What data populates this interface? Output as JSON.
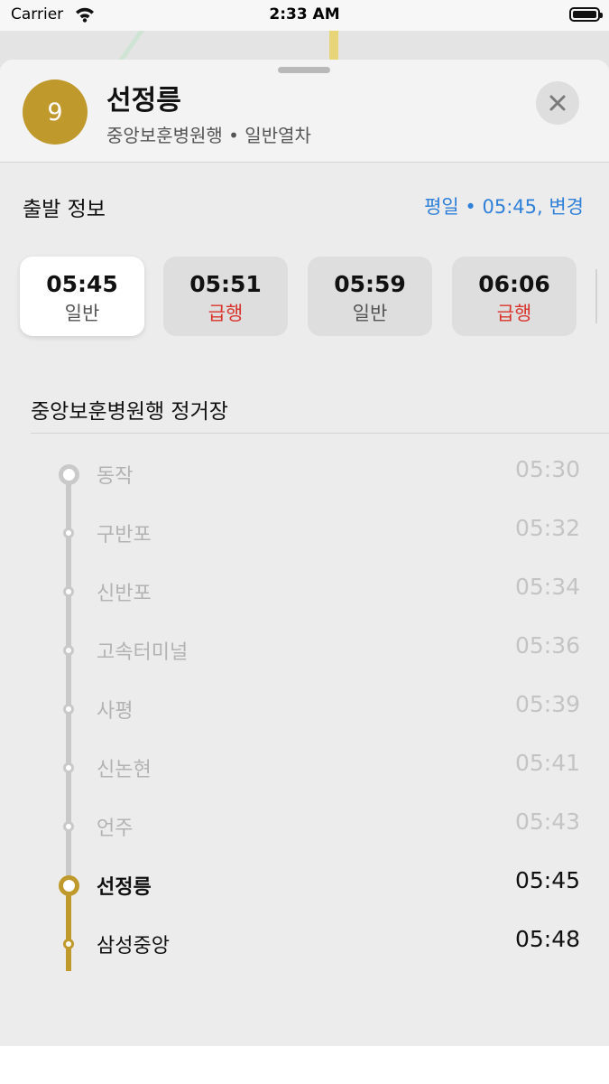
{
  "status_bar": {
    "carrier": "Carrier",
    "time": "2:33 AM"
  },
  "header": {
    "line_number": "9",
    "line_color": "#c0992d",
    "station_name": "선정릉",
    "subtitle": "중앙보훈병원행 • 일반열차"
  },
  "departure": {
    "title": "출발 정보",
    "link": "평일 • 05:45, 변경"
  },
  "times": [
    {
      "time": "05:45",
      "type": "일반",
      "selected": true,
      "express": false
    },
    {
      "time": "05:51",
      "type": "급행",
      "selected": false,
      "express": true
    },
    {
      "time": "05:59",
      "type": "일반",
      "selected": false,
      "express": false
    },
    {
      "time": "06:06",
      "type": "급행",
      "selected": false,
      "express": true
    }
  ],
  "stops_title": "중앙보훈병원행 정거장",
  "stops": [
    {
      "name": "동작",
      "time": "05:30",
      "state": "past"
    },
    {
      "name": "구반포",
      "time": "05:32",
      "state": "past"
    },
    {
      "name": "신반포",
      "time": "05:34",
      "state": "past"
    },
    {
      "name": "고속터미널",
      "time": "05:36",
      "state": "past"
    },
    {
      "name": "사평",
      "time": "05:39",
      "state": "past"
    },
    {
      "name": "신논현",
      "time": "05:41",
      "state": "past"
    },
    {
      "name": "언주",
      "time": "05:43",
      "state": "past"
    },
    {
      "name": "선정릉",
      "time": "05:45",
      "state": "current"
    },
    {
      "name": "삼성중앙",
      "time": "05:48",
      "state": "future"
    }
  ],
  "colors": {
    "accent_link": "#2f80d8",
    "express_red": "#d9342b",
    "line_gold": "#c0992d"
  },
  "icons": {
    "close": "close-icon",
    "wifi": "wifi-icon",
    "battery": "battery-icon"
  }
}
